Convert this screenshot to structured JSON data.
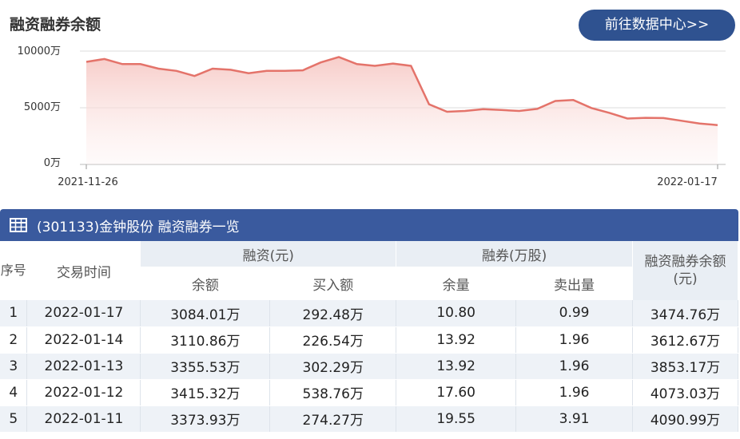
{
  "title": "融资融券余额",
  "datacenter_button": "前往数据中心>>",
  "chart_data": {
    "type": "area",
    "x_start_label": "2021-11-26",
    "x_end_label": "2022-01-17",
    "y_tick_labels": [
      "10000万",
      "5000万",
      "0万"
    ],
    "ylim": [
      0,
      10000
    ],
    "values": [
      9050,
      9300,
      8850,
      8850,
      8450,
      8250,
      7800,
      8450,
      8350,
      8050,
      8250,
      8250,
      8300,
      9000,
      9480,
      8850,
      8700,
      8900,
      8700,
      5300,
      4650,
      4720,
      4880,
      4800,
      4720,
      4900,
      5600,
      5680,
      4980,
      4550,
      4050,
      4110,
      4090,
      3850,
      3613,
      3475
    ],
    "colors": {
      "line": "#e4736a",
      "fill_top": "#f6c7c3"
    }
  },
  "table": {
    "title": "(301133)金钟股份 融资融券一览",
    "headers": {
      "seq": "序号",
      "date": "交易时间",
      "margin_group": "融资(元)",
      "short_group": "融券(万股)",
      "total": "融资融券余额(元)",
      "margin_balance": "余额",
      "margin_buy": "买入额",
      "short_balance": "余量",
      "short_sell": "卖出量"
    },
    "rows": [
      {
        "seq": "1",
        "date": "2022-01-17",
        "mb": "3084.01万",
        "buy": "292.48万",
        "sb": "10.80",
        "sell": "0.99",
        "total": "3474.76万"
      },
      {
        "seq": "2",
        "date": "2022-01-14",
        "mb": "3110.86万",
        "buy": "226.54万",
        "sb": "13.92",
        "sell": "1.96",
        "total": "3612.67万"
      },
      {
        "seq": "3",
        "date": "2022-01-13",
        "mb": "3355.53万",
        "buy": "302.29万",
        "sb": "13.92",
        "sell": "1.96",
        "total": "3853.17万"
      },
      {
        "seq": "4",
        "date": "2022-01-12",
        "mb": "3415.32万",
        "buy": "538.76万",
        "sb": "17.60",
        "sell": "1.96",
        "total": "4073.03万"
      },
      {
        "seq": "5",
        "date": "2022-01-11",
        "mb": "3373.93万",
        "buy": "274.27万",
        "sb": "19.55",
        "sell": "3.91",
        "total": "4090.99万"
      }
    ]
  }
}
